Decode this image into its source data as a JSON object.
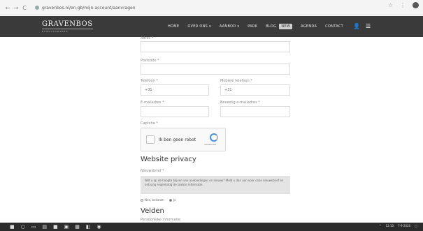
{
  "browser": {
    "back_icon": "←",
    "forward_icon": "→",
    "reload_icon": "C",
    "url": "gravenbos.nl/en-gb/mijn-account/aanvragen",
    "star_icon": "☆",
    "extension_icon": "⋮"
  },
  "header": {
    "logo": "GRAVENBOS",
    "logo_sub": "BUNGALOWPARK",
    "menu": [
      "HOME",
      "OVER ONS ▾",
      "AANBOD ▾",
      "PARK",
      "BLOG",
      "NEW",
      "AGENDA",
      "CONTACT"
    ],
    "user_icon": "👤",
    "menu_icon": "☰"
  },
  "form": {
    "field_top_label": "Adres *",
    "postcode_label": "Postcode *",
    "phone_label": "Telefoon *",
    "mobile_label": "Mobiele telefoon *",
    "phone_prefix": "+31",
    "mobile_prefix": "+31",
    "email_label": "E-mailadres *",
    "email_confirm_label": "Bevestig e-mailadres *",
    "captcha_label": "Captcha *",
    "captcha_text": "Ik ben geen robot",
    "captcha_brand": "reCAPTCHA"
  },
  "privacy": {
    "title": "Website privacy",
    "field_label": "Nieuwsbrief *",
    "notice": "Wilt u op de hoogte blijven van aanbiedingen en nieuws? Meld u dan aan voor onze nieuwsbrief en ontvang regelmatig de laatste informatie.",
    "option_no": "Nee, bedankt",
    "option_yes": "Ja"
  },
  "next_section": {
    "title": "Velden",
    "sub": "Persoonlijke informatie"
  },
  "taskbar": {
    "time": "12:10",
    "date": "7-9-2020"
  }
}
